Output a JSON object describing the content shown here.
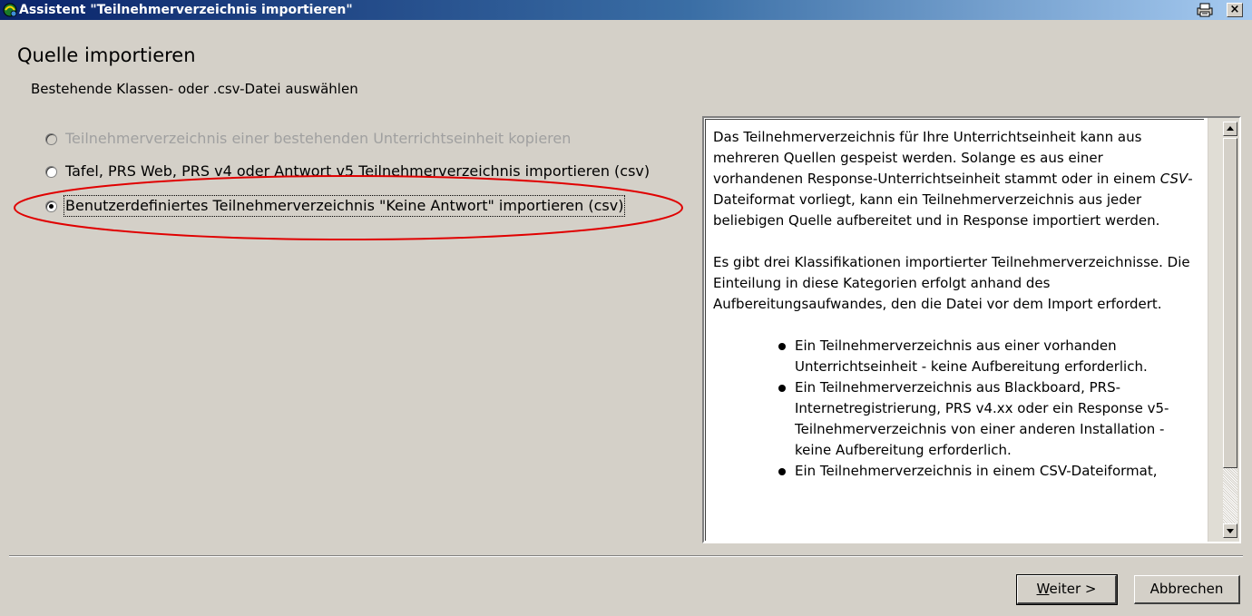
{
  "window": {
    "title": "Assistent \"Teilnehmerverzeichnis importieren\"",
    "icons": {
      "app": "wizard-icon",
      "print": "print-icon",
      "close": "close-icon"
    },
    "close_label": "×"
  },
  "page": {
    "heading": "Quelle importieren",
    "subheading": "Bestehende Klassen- oder .csv-Datei auswählen"
  },
  "options": [
    {
      "label": "Teilnehmerverzeichnis einer bestehenden Unterrichtseinheit kopieren",
      "selected": false,
      "enabled": false
    },
    {
      "label": "Tafel, PRS Web, PRS v4 oder Antwort v5 Teilnehmerverzeichnis importieren (csv)",
      "selected": false,
      "enabled": true
    },
    {
      "label": "Benutzerdefiniertes Teilnehmerverzeichnis \"Keine Antwort\" importieren (csv)",
      "selected": true,
      "enabled": true
    }
  ],
  "highlight_color": "#e00000",
  "info": {
    "para1_a": "Das Teilnehmerverzeichnis für Ihre Unterrichtseinheit kann aus mehreren Quellen gespeist werden. Solange es aus einer vorhandenen Response-Unterrichtseinheit stammt oder in einem ",
    "para1_em": "CSV",
    "para1_b": "-Dateiformat vorliegt, kann ein Teilnehmerverzeichnis aus jeder beliebigen Quelle aufbereitet und in Response importiert werden.",
    "para2": "Es gibt drei Klassifikationen importierter Teilnehmerverzeichnisse. Die Einteilung in diese Kategorien erfolgt anhand des Aufbereitungsaufwandes, den die Datei vor dem Import erfordert.",
    "bullets": [
      "Ein Teilnehmerverzeichnis aus einer vorhanden Unterrichtseinheit - keine Aufbereitung erforderlich.",
      "Ein Teilnehmerverzeichnis aus Blackboard, PRS-Internetregistrierung, PRS v4.xx oder ein Response v5-Teilnehmerverzeichnis von einer anderen Installation - keine Aufbereitung erforderlich.",
      "Ein Teilnehmerverzeichnis in einem CSV-Dateiformat,"
    ]
  },
  "buttons": {
    "next_mnemonic": "W",
    "next_rest": "eiter >",
    "cancel": "Abbrechen"
  }
}
